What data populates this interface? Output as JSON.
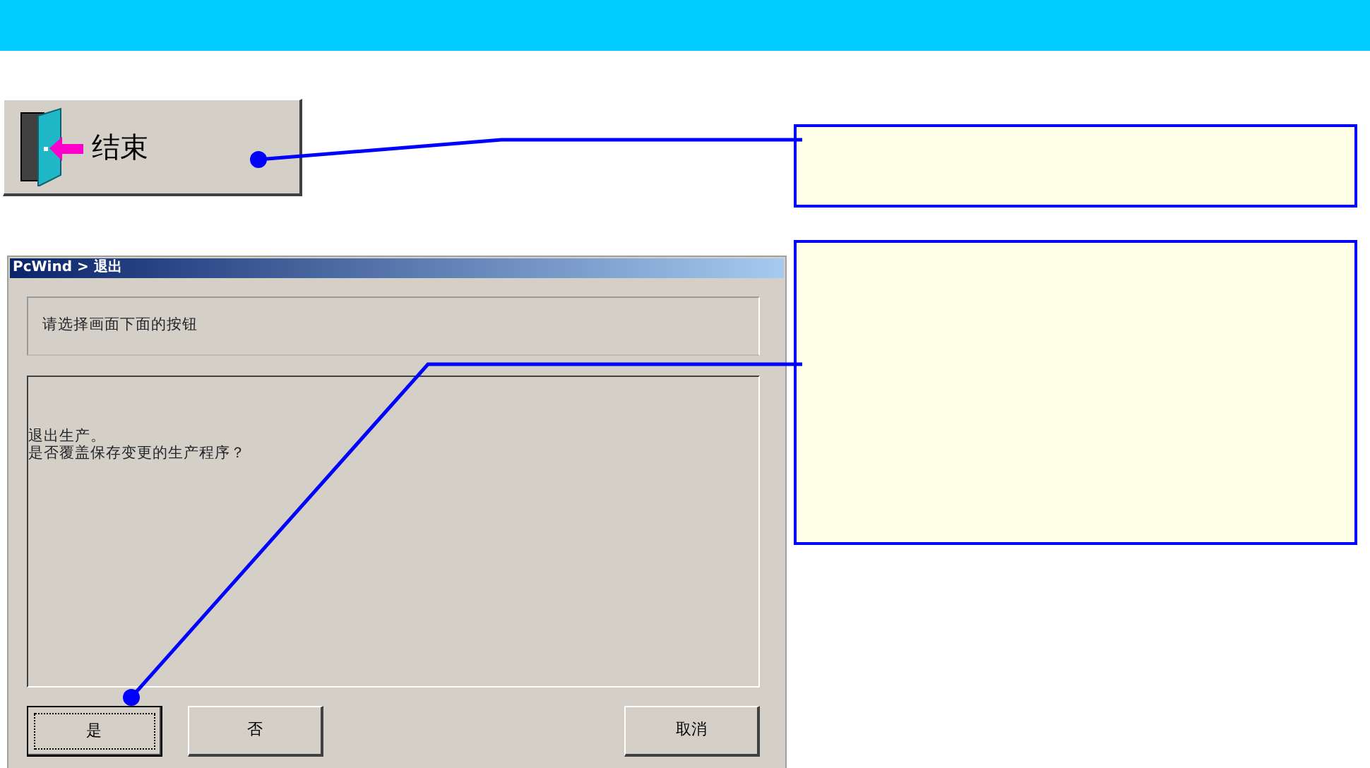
{
  "exit_button": {
    "label": "结束"
  },
  "dialog": {
    "title": "PcWind > 退出",
    "prompt": "请选择画面下面的按钮",
    "message": [
      "退出生产。",
      "是否覆盖保存变更的生产程序？"
    ],
    "buttons": [
      {
        "label": "是",
        "focused": true
      },
      {
        "label": "否",
        "focused": false
      },
      {
        "label": "取消",
        "focused": false
      }
    ]
  },
  "callouts": [
    {
      "kind": "note"
    },
    {
      "kind": "note"
    }
  ]
}
